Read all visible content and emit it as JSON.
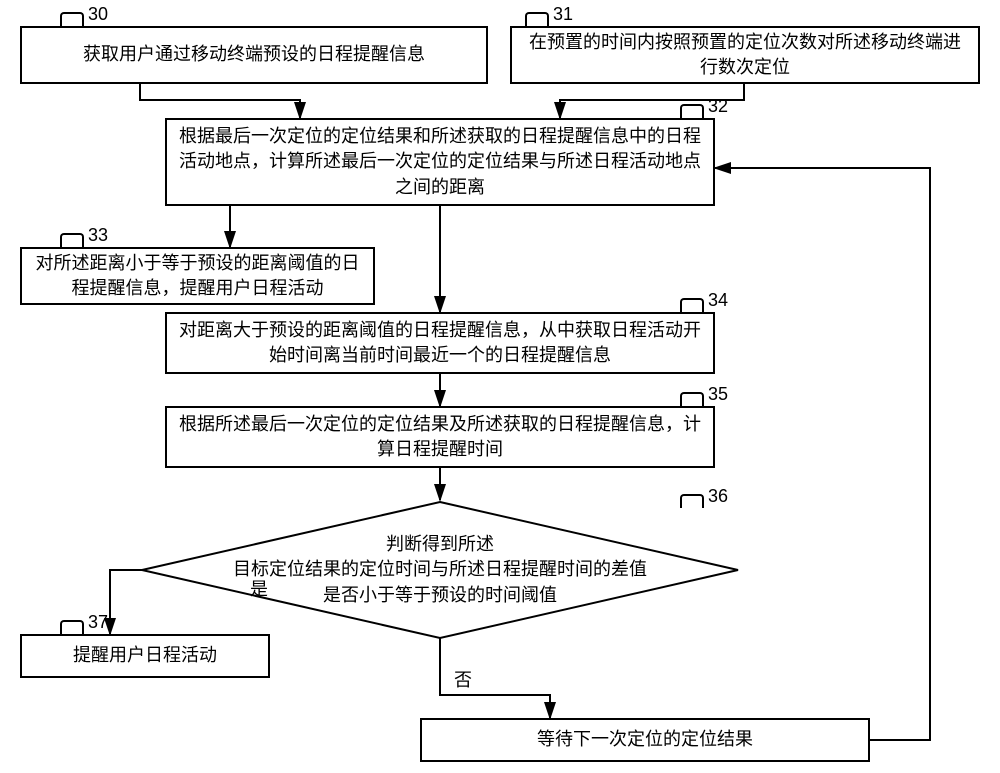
{
  "steps": {
    "s30": {
      "num": "30",
      "text": "获取用户通过移动终端预设的日程提醒信息"
    },
    "s31": {
      "num": "31",
      "text": "在预置的时间内按照预置的定位次数对所述移动终端进行数次定位"
    },
    "s32": {
      "num": "32",
      "text": "根据最后一次定位的定位结果和所述获取的日程提醒信息中的日程活动地点，计算所述最后一次定位的定位结果与所述日程活动地点之间的距离"
    },
    "s33": {
      "num": "33",
      "text": "对所述距离小于等于预设的距离阈值的日程提醒信息，提醒用户日程活动"
    },
    "s34": {
      "num": "34",
      "text": "对距离大于预设的距离阈值的日程提醒信息，从中获取日程活动开始时间离当前时间最近一个的日程提醒信息"
    },
    "s35": {
      "num": "35",
      "text": "根据所述最后一次定位的定位结果及所述获取的日程提醒信息，计算日程提醒时间"
    },
    "s36": {
      "num": "36",
      "text": "判断得到所述\n目标定位结果的定位时间与所述日程提醒时间的差值\n是否小于等于预设的时间阈值"
    },
    "s37": {
      "num": "37",
      "text": "提醒用户日程活动"
    },
    "sWait": {
      "text": "等待下一次定位的定位结果"
    }
  },
  "branch": {
    "yes": "是",
    "no": "否"
  }
}
